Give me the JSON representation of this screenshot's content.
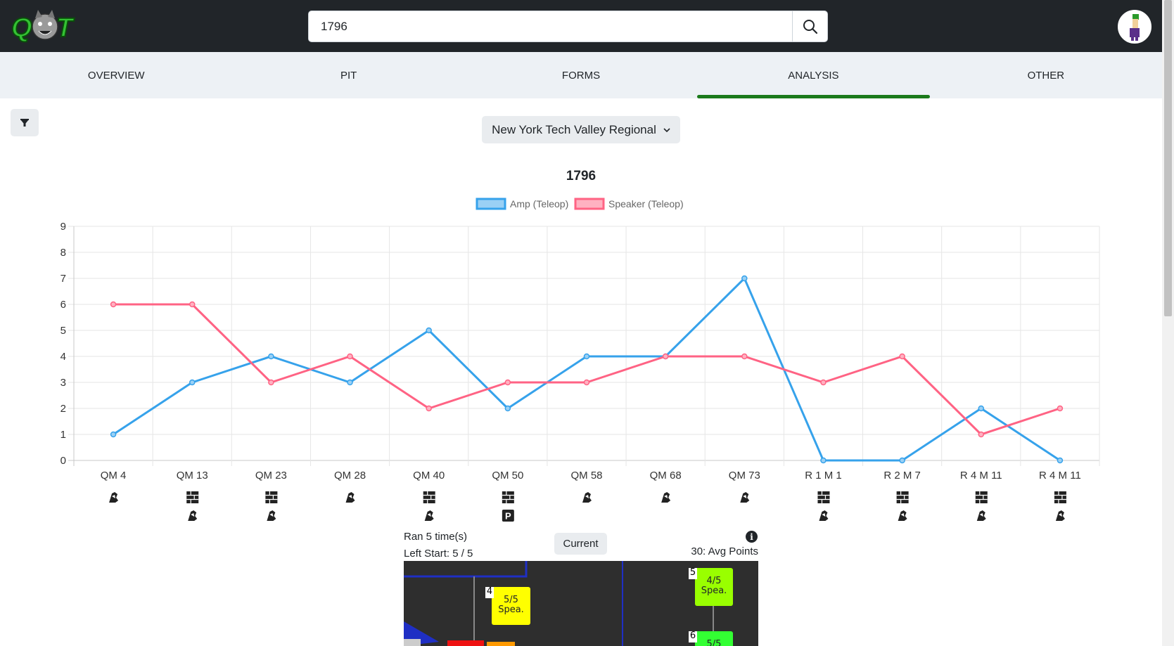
{
  "app": {
    "logo_text": "QOT"
  },
  "search": {
    "value": "1796",
    "placeholder": ""
  },
  "nav": {
    "tabs": [
      {
        "label": "OVERVIEW",
        "active": false
      },
      {
        "label": "PIT",
        "active": false
      },
      {
        "label": "FORMS",
        "active": false
      },
      {
        "label": "ANALYSIS",
        "active": true
      },
      {
        "label": "OTHER",
        "active": false
      }
    ]
  },
  "filter": {
    "icon": "filter-icon"
  },
  "event_select": {
    "value": "New York Tech Valley Regional"
  },
  "chart_data": {
    "type": "line",
    "title": "1796",
    "xlabel": "",
    "ylabel": "",
    "ylim": [
      0,
      9
    ],
    "grid": true,
    "legend": "top",
    "categories": [
      "QM 4",
      "QM 13",
      "QM 23",
      "QM 28",
      "QM 40",
      "QM 50",
      "QM 58",
      "QM 68",
      "QM 73",
      "R 1 M 1",
      "R 2 M 7",
      "R 4 M 11",
      "R 4 M 11"
    ],
    "series": [
      {
        "name": "Amp (Teleop)",
        "color": "#36a2eb",
        "fill": "#9ad0f5",
        "values": [
          1,
          3,
          4,
          3,
          5,
          2,
          4,
          4,
          7,
          0,
          0,
          2,
          0
        ]
      },
      {
        "name": "Speaker (Teleop)",
        "color": "#ff6384",
        "fill": "#ffb1c1",
        "values": [
          6,
          6,
          3,
          4,
          2,
          3,
          3,
          4,
          4,
          3,
          4,
          1,
          2
        ]
      }
    ],
    "tick_icons": [
      [
        "robot-arm-icon"
      ],
      [
        "brick-wall-icon",
        "robot-arm-icon"
      ],
      [
        "brick-wall-icon",
        "robot-arm-icon"
      ],
      [
        "robot-arm-icon"
      ],
      [
        "brick-wall-icon",
        "robot-arm-icon"
      ],
      [
        "brick-wall-icon",
        "parking-icon"
      ],
      [
        "robot-arm-icon"
      ],
      [
        "robot-arm-icon"
      ],
      [
        "robot-arm-icon"
      ],
      [
        "brick-wall-icon",
        "robot-arm-icon"
      ],
      [
        "brick-wall-icon",
        "robot-arm-icon"
      ],
      [
        "brick-wall-icon",
        "robot-arm-icon"
      ],
      [
        "brick-wall-icon",
        "robot-arm-icon"
      ]
    ]
  },
  "auto_summary": {
    "ran_text": "Ran 5 time(s)",
    "left_start_text": "Left Start: 5 / 5",
    "current_label": "Current",
    "avg_points_text": "30: Avg Points"
  },
  "field": {
    "nodes": [
      {
        "num": "4",
        "text_top": "5/5",
        "text_bottom": "Spea.",
        "color": "#ffff00"
      },
      {
        "num": "5",
        "text_top": "4/5",
        "text_bottom": "Spea.",
        "color": "#99ff00"
      },
      {
        "num": "6",
        "text_top": "5/5",
        "text_bottom": "",
        "color": "#33ff33"
      }
    ]
  },
  "colors": {
    "topbar": "#212529",
    "nav_bg": "#edf1f5",
    "active_underline": "#1b7a1b"
  }
}
